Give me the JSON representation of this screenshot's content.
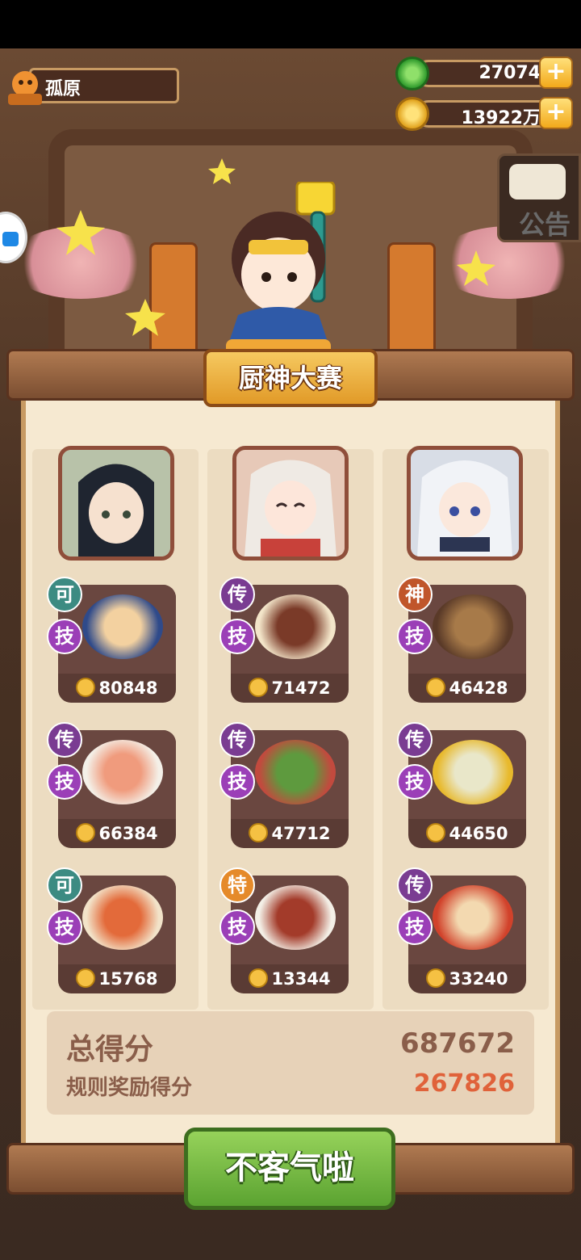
{
  "player": {
    "name": "孤原"
  },
  "currency": {
    "jade": "27074",
    "coins": "13922万"
  },
  "notice": {
    "label": "公告"
  },
  "event": {
    "title": "厨神大赛"
  },
  "columns": [
    {
      "dishes": [
        {
          "grade": "可",
          "gradeClass": "g-ke",
          "skill": "技",
          "score": "80848",
          "food": "#f3d1a0"
        },
        {
          "grade": "传",
          "gradeClass": "g-chuan",
          "skill": "技",
          "score": "66384",
          "food": "#f09b7d"
        },
        {
          "grade": "可",
          "gradeClass": "g-ke",
          "skill": "技",
          "score": "15768",
          "food": "#e36a3a"
        }
      ]
    },
    {
      "dishes": [
        {
          "grade": "传",
          "gradeClass": "g-chuan",
          "skill": "技",
          "score": "71472",
          "food": "#7a3a28"
        },
        {
          "grade": "传",
          "gradeClass": "g-chuan",
          "skill": "技",
          "score": "47712",
          "food": "#5e9a3e"
        },
        {
          "grade": "特",
          "gradeClass": "g-te",
          "skill": "技",
          "score": "13344",
          "food": "#a33b2a"
        }
      ]
    },
    {
      "dishes": [
        {
          "grade": "神",
          "gradeClass": "g-shen",
          "skill": "技",
          "score": "46428",
          "food": "#a77a49"
        },
        {
          "grade": "传",
          "gradeClass": "g-chuan",
          "skill": "技",
          "score": "44650",
          "food": "#e9e7c9"
        },
        {
          "grade": "传",
          "gradeClass": "g-chuan",
          "skill": "技",
          "score": "33240",
          "food": "#d1422b"
        }
      ]
    }
  ],
  "score": {
    "total_label": "总得分",
    "total_value": "687672",
    "bonus_label": "规则奖励得分",
    "bonus_value": "267826"
  },
  "cta": {
    "label": "不客气啦"
  },
  "colors": {
    "bonus": "#e0623a",
    "total": "#8a5e4a"
  }
}
